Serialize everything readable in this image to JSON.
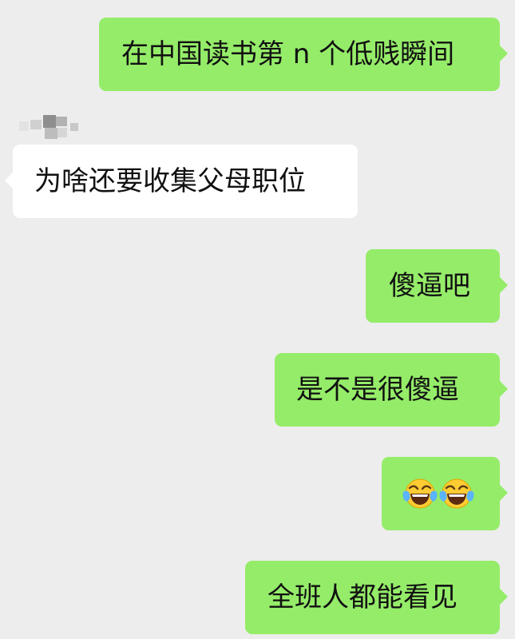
{
  "conversation": {
    "sender_name_hidden": true,
    "messages": [
      {
        "direction": "outgoing",
        "text": "在中国读书第 n 个低贱瞬间"
      },
      {
        "direction": "incoming",
        "text": "为啥还要收集父母职位"
      },
      {
        "direction": "outgoing",
        "text": "傻逼吧"
      },
      {
        "direction": "outgoing",
        "text": "是不是很傻逼"
      },
      {
        "direction": "outgoing",
        "emoji": [
          "face-with-tears-of-joy",
          "face-with-tears-of-joy"
        ]
      },
      {
        "direction": "outgoing",
        "text": "全班人都能看见"
      }
    ]
  },
  "colors": {
    "background": "#ededed",
    "outgoing_bubble": "#95ec69",
    "incoming_bubble": "#ffffff",
    "text": "#111111"
  }
}
